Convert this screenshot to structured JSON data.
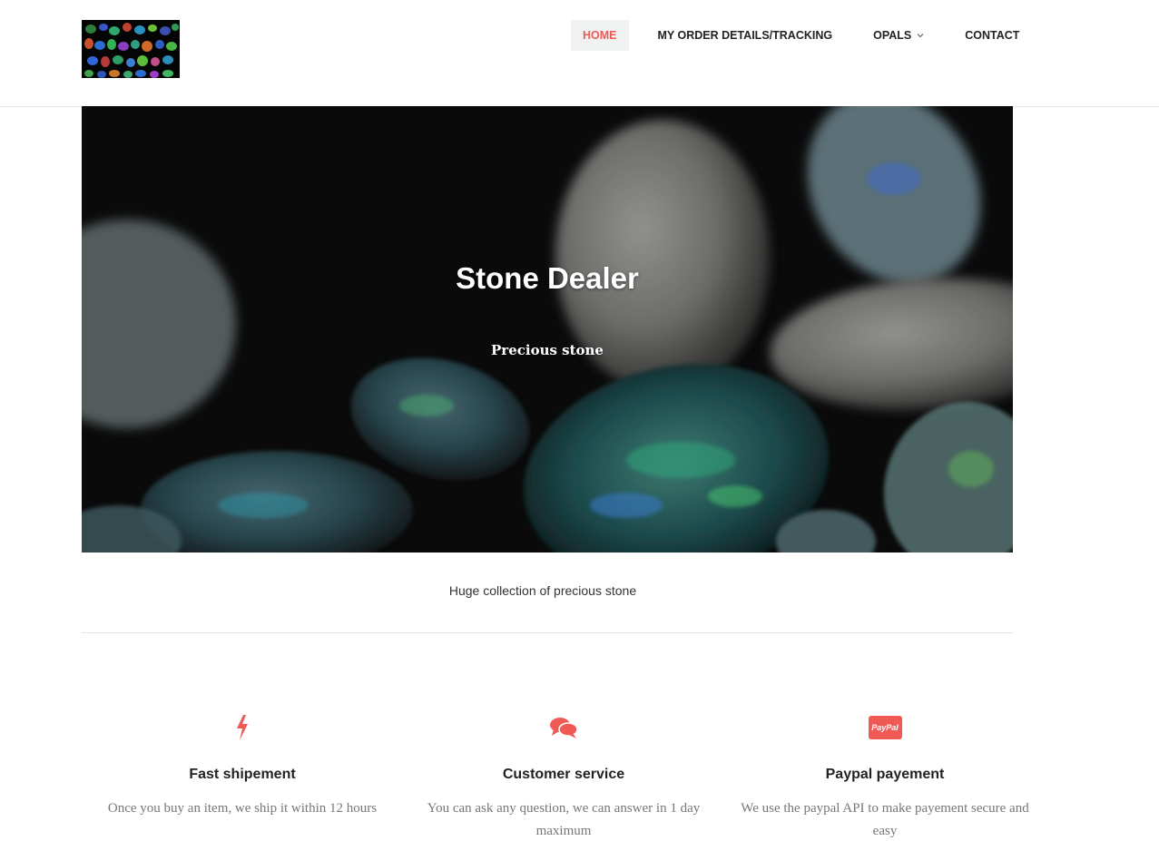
{
  "colors": {
    "accent": "#f05a55",
    "nav_active_bg": "#f0f2f2",
    "text_dark": "#222222",
    "text_muted": "#777777"
  },
  "header": {
    "logo_alt": "opal-collection-logo",
    "nav": [
      {
        "label": "HOME",
        "active": true
      },
      {
        "label": "MY ORDER DETAILS/TRACKING",
        "active": false
      },
      {
        "label": "OPALS",
        "active": false,
        "has_dropdown": true
      },
      {
        "label": "CONTACT",
        "active": false
      }
    ]
  },
  "hero": {
    "title": "Stone Dealer",
    "subtitle": "Precious stone"
  },
  "tagline": "Huge collection of precious stone",
  "features": [
    {
      "icon": "lightning-bolt-icon",
      "title": "Fast shipement",
      "text": "Once you buy an item, we ship it within 12 hours"
    },
    {
      "icon": "chat-bubbles-icon",
      "title": "Customer service",
      "text": "You can ask any question, we can answer in 1 day maximum"
    },
    {
      "icon": "paypal-icon",
      "icon_text": "PayPal",
      "title": "Paypal payement",
      "text": "We use the paypal API to make payement secure and easy"
    }
  ]
}
